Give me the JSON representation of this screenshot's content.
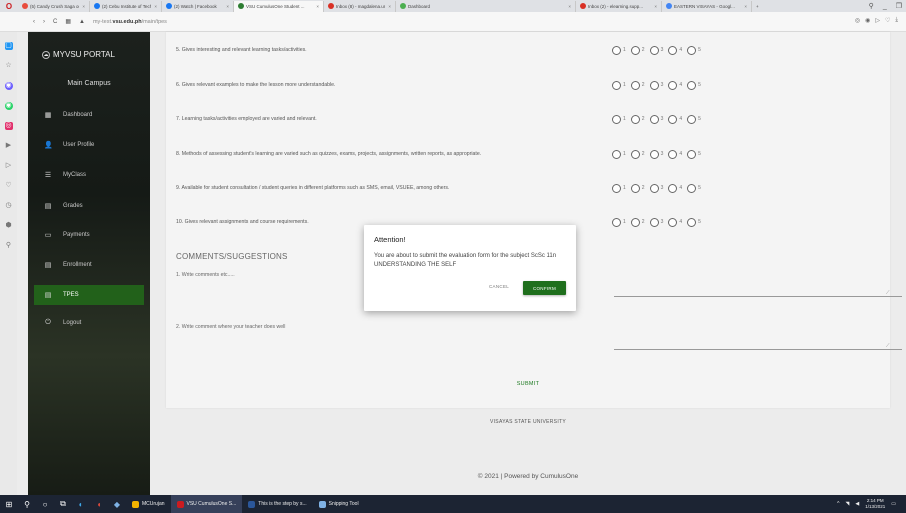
{
  "browser": {
    "tabs": [
      {
        "label": "(5) Candy Crush Saga on F...",
        "color": "#e84c3d",
        "active": false
      },
      {
        "label": "(2) Cebu Institute of Techn...",
        "color": "#1877f2",
        "active": false
      },
      {
        "label": "(2) Watch | Facebook",
        "color": "#1877f2",
        "active": false
      },
      {
        "label": "VSU CumulusOne Student ...",
        "color": "#2e7d32",
        "active": true
      },
      {
        "label": "Inbox (8) - magdalena.unc...",
        "color": "#d93025",
        "active": false
      },
      {
        "label": "Dashboard",
        "color": "#4caf50",
        "active": false
      },
      {
        "label": "Inbox (2) - elearning.supp...",
        "color": "#d93025",
        "active": false
      },
      {
        "label": "EASTERN VISAYAS - Googl...",
        "color": "#4285f4",
        "active": false
      }
    ],
    "url_prefix": "my-test.",
    "url_domain": "vsu.edu.ph",
    "url_path": "/main/tpes"
  },
  "sidebar": {
    "portal_name": "MYVSU PORTAL",
    "campus": "Main Campus",
    "items": [
      {
        "label": "Dashboard",
        "icon": "dashboard-icon",
        "glyph": "▦"
      },
      {
        "label": "User Profile",
        "icon": "user-icon",
        "glyph": "👤"
      },
      {
        "label": "MyClass",
        "icon": "list-icon",
        "glyph": "☰"
      },
      {
        "label": "Grades",
        "icon": "grades-icon",
        "glyph": "▤"
      },
      {
        "label": "Payments",
        "icon": "payments-icon",
        "glyph": "▭"
      },
      {
        "label": "Enrollment",
        "icon": "enrollment-icon",
        "glyph": "▤"
      },
      {
        "label": "TPES",
        "icon": "tpes-icon",
        "glyph": "▤"
      },
      {
        "label": "Logout",
        "icon": "logout-icon",
        "glyph": "⏻"
      }
    ],
    "active_index": 6
  },
  "form": {
    "questions": [
      "5. Gives interesting and relevant learning tasks/activities.",
      "6. Gives relevant examples to make the lesson more understandable.",
      "7. Learning tasks/activities employed are varied and relevant.",
      "8. Methods of assessing student's learning are varied such as quizzes, exams, projects, assignments, written reports, as appropriate.",
      "9. Available for student consultation / student queries in different platforms such as SMS, email, VSUEE, among others.",
      "10. Gives relevant assignments and course requirements."
    ],
    "rating_options": [
      "1",
      "2",
      "3",
      "4",
      "5"
    ],
    "comments_title": "COMMENTS/SUGGESTIONS",
    "comment1_label": "1. Write comments etc.....",
    "comment2_label": "2. Write comment where your teacher does well",
    "submit_label": "SUBMIT"
  },
  "footer": {
    "university": "VISAYAS STATE UNIVERSITY",
    "copyright": "© 2021 | Powered by CumulusOne"
  },
  "modal": {
    "title": "Attention!",
    "message": "You are about to submit the evaluation form for the subject ScSc 11n UNDERSTANDING THE SELF",
    "cancel_label": "CANCEL",
    "confirm_label": "CONFIRM"
  },
  "taskbar": {
    "apps": [
      {
        "label": "MCUrujan",
        "color": "#f4b400"
      },
      {
        "label": "VSU CumulusOne S...",
        "color": "#cc1b20"
      },
      {
        "label": "This is the step by s...",
        "color": "#2b579a"
      },
      {
        "label": "Snipping Tool",
        "color": "#7fb2e5"
      }
    ],
    "time": "2:14 PM",
    "date": "1/13/2021"
  }
}
